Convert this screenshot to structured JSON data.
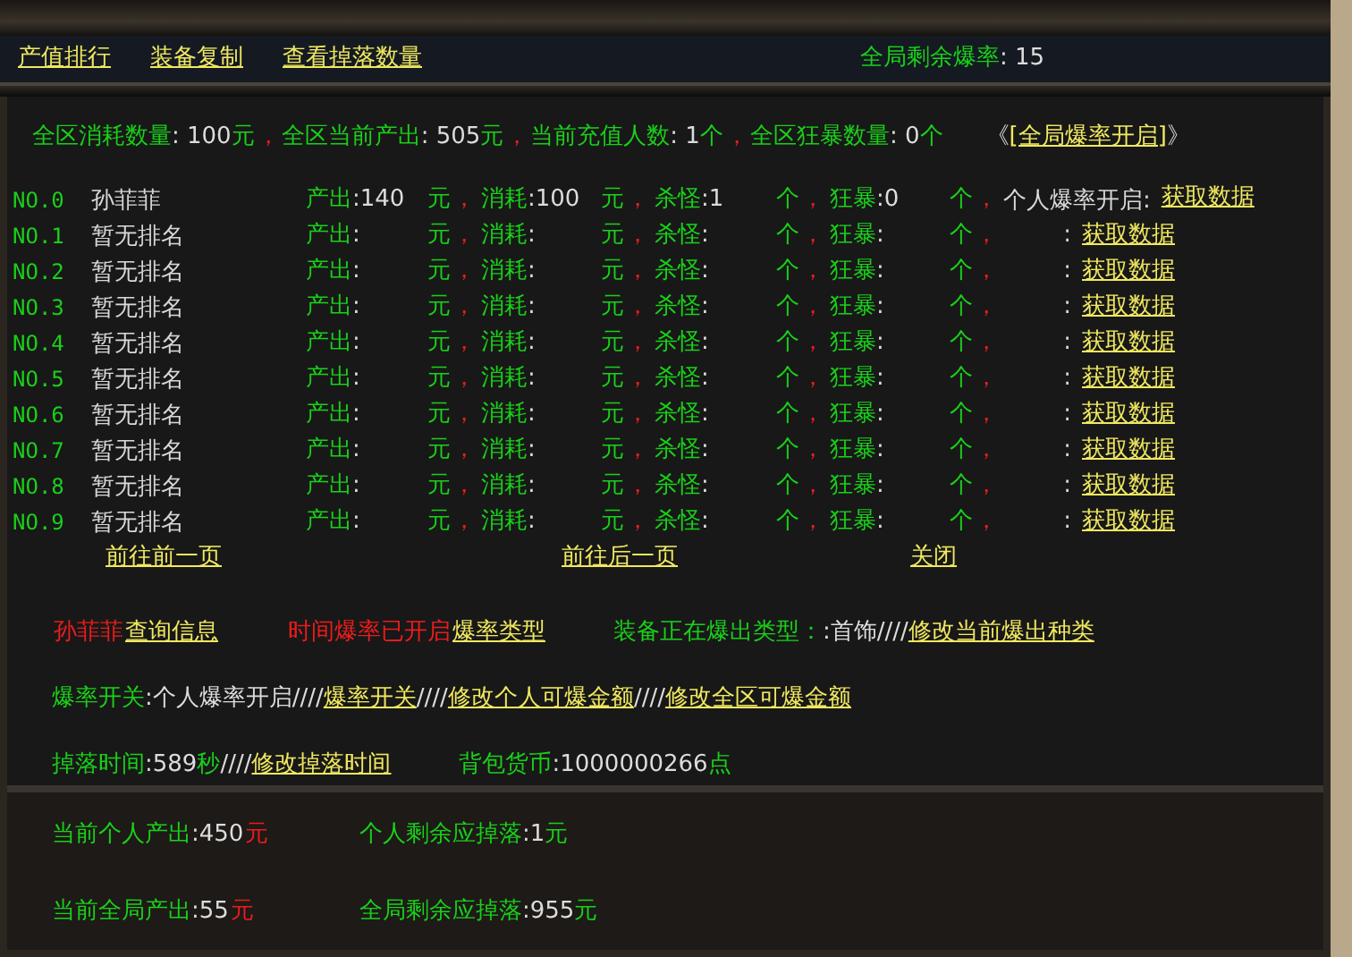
{
  "top_bar": {
    "links": [
      "产值排行",
      "装备复制",
      "查看掉落数量"
    ],
    "global_rate": [
      {
        "kind": "label",
        "text": "全局剩余爆率"
      },
      {
        "kind": "value",
        "text": ": 15"
      }
    ]
  },
  "stats": [
    {
      "kind": "label",
      "text": "全区消耗数量"
    },
    {
      "kind": "value",
      "text": ": 100"
    },
    {
      "kind": "label",
      "text": "元"
    },
    {
      "kind": "alert",
      "text": "，"
    },
    {
      "kind": "label",
      "text": "全区当前产出"
    },
    {
      "kind": "value",
      "text": ": 505"
    },
    {
      "kind": "label",
      "text": "元"
    },
    {
      "kind": "alert",
      "text": "，"
    },
    {
      "kind": "label",
      "text": "当前充值人数"
    },
    {
      "kind": "value",
      "text": ": 1"
    },
    {
      "kind": "label",
      "text": "个"
    },
    {
      "kind": "alert",
      "text": "，"
    },
    {
      "kind": "label",
      "text": "全区狂暴数量"
    },
    {
      "kind": "value",
      "text": ": 0"
    },
    {
      "kind": "label",
      "text": "个"
    }
  ],
  "stats_toggle": [
    {
      "kind": "value",
      "text": "《"
    },
    {
      "kind": "link",
      "text": "[全局爆率开启]"
    },
    {
      "kind": "value",
      "text": "》"
    }
  ],
  "rows": [
    {
      "rank": "NO.0",
      "name": "孙菲菲",
      "cells": [
        [
          {
            "kind": "label",
            "text": "产出"
          },
          {
            "kind": "value",
            "text": ":140"
          }
        ],
        [
          {
            "kind": "label",
            "text": "元"
          },
          {
            "kind": "alert",
            "text": "，"
          }
        ],
        [
          {
            "kind": "label",
            "text": "消耗"
          },
          {
            "kind": "value",
            "text": ":100"
          }
        ],
        [
          {
            "kind": "label",
            "text": "元"
          },
          {
            "kind": "alert",
            "text": "，"
          }
        ],
        [
          {
            "kind": "label",
            "text": "杀怪"
          },
          {
            "kind": "value",
            "text": ":1"
          }
        ],
        [
          {
            "kind": "label",
            "text": "个"
          },
          {
            "kind": "alert",
            "text": "，"
          }
        ],
        [
          {
            "kind": "label",
            "text": "狂暴"
          },
          {
            "kind": "value",
            "text": ":0"
          }
        ],
        [
          {
            "kind": "label",
            "text": "个"
          },
          {
            "kind": "alert",
            "text": "，"
          }
        ]
      ],
      "note": "个人爆率开启:",
      "link": "获取数据"
    },
    {
      "rank": "NO.1",
      "name": "暂无排名",
      "cells": [
        [
          {
            "kind": "label",
            "text": "产出"
          },
          {
            "kind": "value",
            "text": ":"
          }
        ],
        [
          {
            "kind": "label",
            "text": "元"
          },
          {
            "kind": "alert",
            "text": "，"
          }
        ],
        [
          {
            "kind": "label",
            "text": "消耗"
          },
          {
            "kind": "value",
            "text": ":"
          }
        ],
        [
          {
            "kind": "label",
            "text": "元"
          },
          {
            "kind": "alert",
            "text": "，"
          }
        ],
        [
          {
            "kind": "label",
            "text": "杀怪"
          },
          {
            "kind": "value",
            "text": ":"
          }
        ],
        [
          {
            "kind": "label",
            "text": "个"
          },
          {
            "kind": "alert",
            "text": "，"
          }
        ],
        [
          {
            "kind": "label",
            "text": "狂暴"
          },
          {
            "kind": "value",
            "text": ":"
          }
        ],
        [
          {
            "kind": "label",
            "text": "个"
          },
          {
            "kind": "alert",
            "text": "，"
          }
        ]
      ],
      "note": ":",
      "link": "获取数据"
    },
    {
      "rank": "NO.2",
      "name": "暂无排名",
      "cells": [
        [
          {
            "kind": "label",
            "text": "产出"
          },
          {
            "kind": "value",
            "text": ":"
          }
        ],
        [
          {
            "kind": "label",
            "text": "元"
          },
          {
            "kind": "alert",
            "text": "，"
          }
        ],
        [
          {
            "kind": "label",
            "text": "消耗"
          },
          {
            "kind": "value",
            "text": ":"
          }
        ],
        [
          {
            "kind": "label",
            "text": "元"
          },
          {
            "kind": "alert",
            "text": "，"
          }
        ],
        [
          {
            "kind": "label",
            "text": "杀怪"
          },
          {
            "kind": "value",
            "text": ":"
          }
        ],
        [
          {
            "kind": "label",
            "text": "个"
          },
          {
            "kind": "alert",
            "text": "，"
          }
        ],
        [
          {
            "kind": "label",
            "text": "狂暴"
          },
          {
            "kind": "value",
            "text": ":"
          }
        ],
        [
          {
            "kind": "label",
            "text": "个"
          },
          {
            "kind": "alert",
            "text": "，"
          }
        ]
      ],
      "note": ":",
      "link": "获取数据"
    },
    {
      "rank": "NO.3",
      "name": "暂无排名",
      "cells": [
        [
          {
            "kind": "label",
            "text": "产出"
          },
          {
            "kind": "value",
            "text": ":"
          }
        ],
        [
          {
            "kind": "label",
            "text": "元"
          },
          {
            "kind": "alert",
            "text": "，"
          }
        ],
        [
          {
            "kind": "label",
            "text": "消耗"
          },
          {
            "kind": "value",
            "text": ":"
          }
        ],
        [
          {
            "kind": "label",
            "text": "元"
          },
          {
            "kind": "alert",
            "text": "，"
          }
        ],
        [
          {
            "kind": "label",
            "text": "杀怪"
          },
          {
            "kind": "value",
            "text": ":"
          }
        ],
        [
          {
            "kind": "label",
            "text": "个"
          },
          {
            "kind": "alert",
            "text": "，"
          }
        ],
        [
          {
            "kind": "label",
            "text": "狂暴"
          },
          {
            "kind": "value",
            "text": ":"
          }
        ],
        [
          {
            "kind": "label",
            "text": "个"
          },
          {
            "kind": "alert",
            "text": "，"
          }
        ]
      ],
      "note": ":",
      "link": "获取数据"
    },
    {
      "rank": "NO.4",
      "name": "暂无排名",
      "cells": [
        [
          {
            "kind": "label",
            "text": "产出"
          },
          {
            "kind": "value",
            "text": ":"
          }
        ],
        [
          {
            "kind": "label",
            "text": "元"
          },
          {
            "kind": "alert",
            "text": "，"
          }
        ],
        [
          {
            "kind": "label",
            "text": "消耗"
          },
          {
            "kind": "value",
            "text": ":"
          }
        ],
        [
          {
            "kind": "label",
            "text": "元"
          },
          {
            "kind": "alert",
            "text": "，"
          }
        ],
        [
          {
            "kind": "label",
            "text": "杀怪"
          },
          {
            "kind": "value",
            "text": ":"
          }
        ],
        [
          {
            "kind": "label",
            "text": "个"
          },
          {
            "kind": "alert",
            "text": "，"
          }
        ],
        [
          {
            "kind": "label",
            "text": "狂暴"
          },
          {
            "kind": "value",
            "text": ":"
          }
        ],
        [
          {
            "kind": "label",
            "text": "个"
          },
          {
            "kind": "alert",
            "text": "，"
          }
        ]
      ],
      "note": ":",
      "link": "获取数据"
    },
    {
      "rank": "NO.5",
      "name": "暂无排名",
      "cells": [
        [
          {
            "kind": "label",
            "text": "产出"
          },
          {
            "kind": "value",
            "text": ":"
          }
        ],
        [
          {
            "kind": "label",
            "text": "元"
          },
          {
            "kind": "alert",
            "text": "，"
          }
        ],
        [
          {
            "kind": "label",
            "text": "消耗"
          },
          {
            "kind": "value",
            "text": ":"
          }
        ],
        [
          {
            "kind": "label",
            "text": "元"
          },
          {
            "kind": "alert",
            "text": "，"
          }
        ],
        [
          {
            "kind": "label",
            "text": "杀怪"
          },
          {
            "kind": "value",
            "text": ":"
          }
        ],
        [
          {
            "kind": "label",
            "text": "个"
          },
          {
            "kind": "alert",
            "text": "，"
          }
        ],
        [
          {
            "kind": "label",
            "text": "狂暴"
          },
          {
            "kind": "value",
            "text": ":"
          }
        ],
        [
          {
            "kind": "label",
            "text": "个"
          },
          {
            "kind": "alert",
            "text": "，"
          }
        ]
      ],
      "note": ":",
      "link": "获取数据"
    },
    {
      "rank": "NO.6",
      "name": "暂无排名",
      "cells": [
        [
          {
            "kind": "label",
            "text": "产出"
          },
          {
            "kind": "value",
            "text": ":"
          }
        ],
        [
          {
            "kind": "label",
            "text": "元"
          },
          {
            "kind": "alert",
            "text": "，"
          }
        ],
        [
          {
            "kind": "label",
            "text": "消耗"
          },
          {
            "kind": "value",
            "text": ":"
          }
        ],
        [
          {
            "kind": "label",
            "text": "元"
          },
          {
            "kind": "alert",
            "text": "，"
          }
        ],
        [
          {
            "kind": "label",
            "text": "杀怪"
          },
          {
            "kind": "value",
            "text": ":"
          }
        ],
        [
          {
            "kind": "label",
            "text": "个"
          },
          {
            "kind": "alert",
            "text": "，"
          }
        ],
        [
          {
            "kind": "label",
            "text": "狂暴"
          },
          {
            "kind": "value",
            "text": ":"
          }
        ],
        [
          {
            "kind": "label",
            "text": "个"
          },
          {
            "kind": "alert",
            "text": "，"
          }
        ]
      ],
      "note": ":",
      "link": "获取数据"
    },
    {
      "rank": "NO.7",
      "name": "暂无排名",
      "cells": [
        [
          {
            "kind": "label",
            "text": "产出"
          },
          {
            "kind": "value",
            "text": ":"
          }
        ],
        [
          {
            "kind": "label",
            "text": "元"
          },
          {
            "kind": "alert",
            "text": "，"
          }
        ],
        [
          {
            "kind": "label",
            "text": "消耗"
          },
          {
            "kind": "value",
            "text": ":"
          }
        ],
        [
          {
            "kind": "label",
            "text": "元"
          },
          {
            "kind": "alert",
            "text": "，"
          }
        ],
        [
          {
            "kind": "label",
            "text": "杀怪"
          },
          {
            "kind": "value",
            "text": ":"
          }
        ],
        [
          {
            "kind": "label",
            "text": "个"
          },
          {
            "kind": "alert",
            "text": "，"
          }
        ],
        [
          {
            "kind": "label",
            "text": "狂暴"
          },
          {
            "kind": "value",
            "text": ":"
          }
        ],
        [
          {
            "kind": "label",
            "text": "个"
          },
          {
            "kind": "alert",
            "text": "，"
          }
        ]
      ],
      "note": ":",
      "link": "获取数据"
    },
    {
      "rank": "NO.8",
      "name": "暂无排名",
      "cells": [
        [
          {
            "kind": "label",
            "text": "产出"
          },
          {
            "kind": "value",
            "text": ":"
          }
        ],
        [
          {
            "kind": "label",
            "text": "元"
          },
          {
            "kind": "alert",
            "text": "，"
          }
        ],
        [
          {
            "kind": "label",
            "text": "消耗"
          },
          {
            "kind": "value",
            "text": ":"
          }
        ],
        [
          {
            "kind": "label",
            "text": "元"
          },
          {
            "kind": "alert",
            "text": "，"
          }
        ],
        [
          {
            "kind": "label",
            "text": "杀怪"
          },
          {
            "kind": "value",
            "text": ":"
          }
        ],
        [
          {
            "kind": "label",
            "text": "个"
          },
          {
            "kind": "alert",
            "text": "，"
          }
        ],
        [
          {
            "kind": "label",
            "text": "狂暴"
          },
          {
            "kind": "value",
            "text": ":"
          }
        ],
        [
          {
            "kind": "label",
            "text": "个"
          },
          {
            "kind": "alert",
            "text": "，"
          }
        ]
      ],
      "note": ":",
      "link": "获取数据"
    },
    {
      "rank": "NO.9",
      "name": "暂无排名",
      "cells": [
        [
          {
            "kind": "label",
            "text": "产出"
          },
          {
            "kind": "value",
            "text": ":"
          }
        ],
        [
          {
            "kind": "label",
            "text": "元"
          },
          {
            "kind": "alert",
            "text": "，"
          }
        ],
        [
          {
            "kind": "label",
            "text": "消耗"
          },
          {
            "kind": "value",
            "text": ":"
          }
        ],
        [
          {
            "kind": "label",
            "text": "元"
          },
          {
            "kind": "alert",
            "text": "，"
          }
        ],
        [
          {
            "kind": "label",
            "text": "杀怪"
          },
          {
            "kind": "value",
            "text": ":"
          }
        ],
        [
          {
            "kind": "label",
            "text": "个"
          },
          {
            "kind": "alert",
            "text": "，"
          }
        ],
        [
          {
            "kind": "label",
            "text": "狂暴"
          },
          {
            "kind": "value",
            "text": ":"
          }
        ],
        [
          {
            "kind": "label",
            "text": "个"
          },
          {
            "kind": "alert",
            "text": "，"
          }
        ]
      ],
      "note": ":",
      "link": "获取数据"
    }
  ],
  "pager": [
    "前往前一页",
    "前往后一页",
    "关闭"
  ],
  "info_lines": [
    [
      [
        {
          "kind": "alert",
          "text": "孙菲菲"
        },
        {
          "kind": "link",
          "text": "查询信息"
        }
      ],
      [
        {
          "kind": "alert",
          "text": "时间爆率已开启"
        },
        {
          "kind": "link",
          "text": "爆率类型"
        }
      ],
      [
        {
          "kind": "label",
          "text": "装备正在爆出类型："
        },
        {
          "kind": "value",
          "text": ":首饰////"
        },
        {
          "kind": "link",
          "text": "修改当前爆出种类"
        }
      ]
    ],
    [
      [
        {
          "kind": "label",
          "text": "爆率开关"
        },
        {
          "kind": "value",
          "text": ":个人爆率开启////"
        },
        {
          "kind": "link",
          "text": "爆率开关"
        },
        {
          "kind": "value",
          "text": "////"
        },
        {
          "kind": "link",
          "text": "修改个人可爆金额"
        },
        {
          "kind": "value",
          "text": "////"
        },
        {
          "kind": "link",
          "text": "修改全区可爆金额"
        }
      ]
    ],
    [
      [
        {
          "kind": "label",
          "text": "掉落时间"
        },
        {
          "kind": "value",
          "text": ":589"
        },
        {
          "kind": "label",
          "text": "秒"
        },
        {
          "kind": "value",
          "text": "////"
        },
        {
          "kind": "link",
          "text": "修改掉落时间"
        }
      ],
      [
        {
          "kind": "label",
          "text": "背包货币"
        },
        {
          "kind": "value",
          "text": ":1000000266"
        },
        {
          "kind": "label",
          "text": "点"
        }
      ]
    ]
  ],
  "bottom_lines": [
    [
      [
        {
          "kind": "label",
          "text": "当前个人产出"
        },
        {
          "kind": "value",
          "text": ":450"
        },
        {
          "kind": "alert",
          "text": "元"
        }
      ],
      [
        {
          "kind": "label",
          "text": "个人剩余应掉落"
        },
        {
          "kind": "value",
          "text": ":1"
        },
        {
          "kind": "label",
          "text": "元"
        }
      ]
    ],
    [
      [
        {
          "kind": "label",
          "text": "当前全局产出"
        },
        {
          "kind": "value",
          "text": ":55"
        },
        {
          "kind": "alert",
          "text": "元"
        }
      ],
      [
        {
          "kind": "label",
          "text": "全局剩余应掉落"
        },
        {
          "kind": "value",
          "text": ":955"
        },
        {
          "kind": "label",
          "text": "元"
        }
      ]
    ]
  ]
}
